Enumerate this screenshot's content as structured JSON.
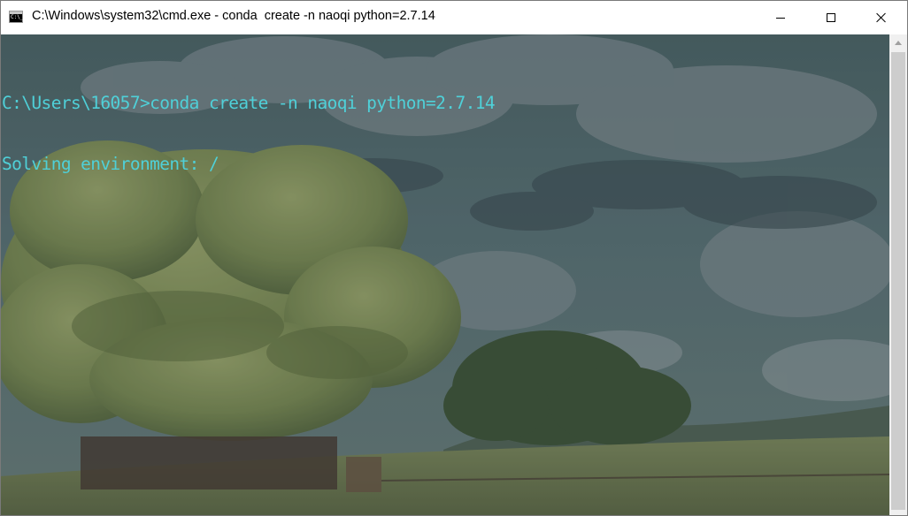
{
  "window": {
    "title": "C:\\Windows\\system32\\cmd.exe - conda  create -n naoqi python=2.7.14",
    "app_icon_glyph": "C:\\_"
  },
  "controls": {
    "minimize_icon": "minimize-icon",
    "maximize_icon": "maximize-icon",
    "close_icon": "close-icon"
  },
  "console": {
    "text_color": "#4fd0d8",
    "lines": [
      "C:\\Users\\16057>conda create -n naoqi python=2.7.14",
      "Solving environment: /"
    ]
  },
  "colors": {
    "titlebar": "#ffffff",
    "scrollbar_track": "#f0f0f0",
    "scrollbar_thumb": "#cdcdcd"
  }
}
